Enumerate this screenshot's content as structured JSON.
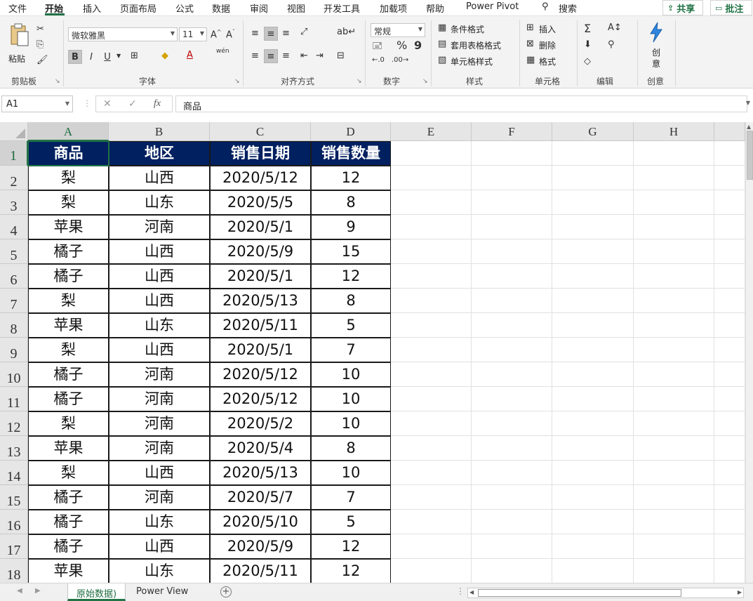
{
  "menu": {
    "tabs": [
      "文件",
      "开始",
      "插入",
      "页面布局",
      "公式",
      "数据",
      "审阅",
      "视图",
      "开发工具",
      "加载项",
      "帮助",
      "Power Pivot"
    ],
    "active_tab": "开始",
    "search_label": "搜索",
    "share_label": "共享",
    "comment_label": "批注"
  },
  "ribbon": {
    "clipboard": {
      "paste_label": "粘贴",
      "group_label": "剪贴板"
    },
    "font": {
      "font_name": "微软雅黑",
      "font_size": "11",
      "bold": "B",
      "italic": "I",
      "underline": "U",
      "phonetic": "wén",
      "group_label": "字体"
    },
    "alignment": {
      "group_label": "对齐方式"
    },
    "number": {
      "format": "常规",
      "percent": "%",
      "comma": "9",
      "group_label": "数字"
    },
    "styles": {
      "conditional_format": "条件格式",
      "table_format": "套用表格格式",
      "cell_styles": "单元格样式",
      "group_label": "样式"
    },
    "cells": {
      "insert": "插入",
      "delete": "删除",
      "format": "格式",
      "group_label": "单元格"
    },
    "editing": {
      "group_label": "编辑"
    },
    "ideas": {
      "label_1": "创",
      "label_2": "意",
      "group_label": "创意"
    }
  },
  "formula_bar": {
    "name_box": "A1",
    "fx_label": "fx",
    "content": "商品"
  },
  "sheet": {
    "columns": [
      "A",
      "B",
      "C",
      "D",
      "E",
      "F",
      "G",
      "H"
    ],
    "row_numbers": [
      "1",
      "2",
      "3",
      "4",
      "5",
      "6",
      "7",
      "8",
      "9",
      "10",
      "11",
      "12",
      "13",
      "14",
      "15",
      "16",
      "17",
      "18"
    ],
    "headers": [
      "商品",
      "地区",
      "销售日期",
      "销售数量"
    ],
    "rows": [
      [
        "梨",
        "山西",
        "2020/5/12",
        "12"
      ],
      [
        "梨",
        "山东",
        "2020/5/5",
        "8"
      ],
      [
        "苹果",
        "河南",
        "2020/5/1",
        "9"
      ],
      [
        "橘子",
        "山西",
        "2020/5/9",
        "15"
      ],
      [
        "橘子",
        "山西",
        "2020/5/1",
        "12"
      ],
      [
        "梨",
        "山西",
        "2020/5/13",
        "8"
      ],
      [
        "苹果",
        "山东",
        "2020/5/11",
        "5"
      ],
      [
        "梨",
        "山西",
        "2020/5/1",
        "7"
      ],
      [
        "橘子",
        "河南",
        "2020/5/12",
        "10"
      ],
      [
        "橘子",
        "河南",
        "2020/5/12",
        "10"
      ],
      [
        "梨",
        "河南",
        "2020/5/2",
        "10"
      ],
      [
        "苹果",
        "河南",
        "2020/5/4",
        "8"
      ],
      [
        "梨",
        "山西",
        "2020/5/13",
        "10"
      ],
      [
        "橘子",
        "河南",
        "2020/5/7",
        "7"
      ],
      [
        "橘子",
        "山东",
        "2020/5/10",
        "5"
      ],
      [
        "橘子",
        "山西",
        "2020/5/9",
        "12"
      ],
      [
        "苹果",
        "山东",
        "2020/5/11",
        "12"
      ]
    ],
    "header_fill_color": "#002060",
    "selected_cell": "A1"
  },
  "sheet_tabs": {
    "tabs": [
      "原始数据)",
      "Power View"
    ],
    "active": "原始数据)"
  }
}
